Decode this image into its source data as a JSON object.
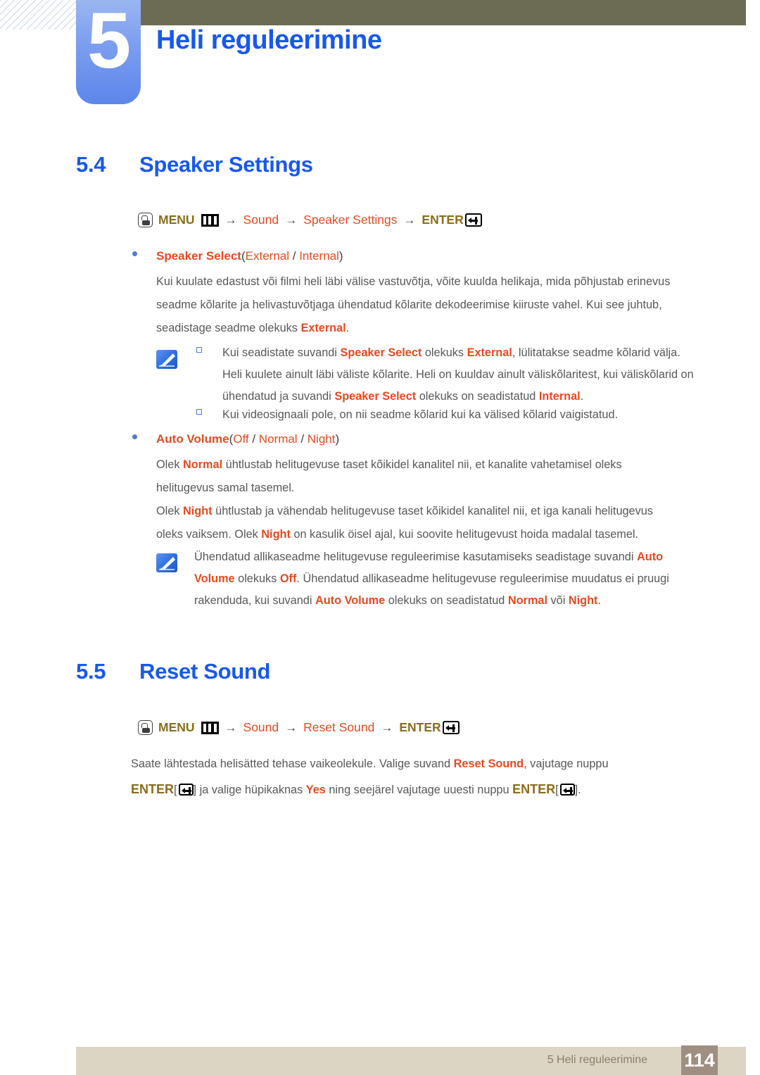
{
  "header": {
    "chapter_number": "5",
    "chapter_title": "Heli reguleerimine"
  },
  "sections": [
    {
      "number": "5.4",
      "title": "Speaker Settings",
      "menu_path": {
        "menu_label": "MENU",
        "arrow": "→",
        "step1": "Sound",
        "step2": "Speaker Settings",
        "enter_label": "ENTER"
      },
      "bullet": {
        "name": "Speaker Select",
        "options_open": "(",
        "option1": "External",
        "sep": " / ",
        "option2": "Internal",
        "options_close": ")"
      },
      "paragraph": {
        "line1_a": "Kui kuulate edastust või filmi heli läbi välise vastuvõtja, võite kuulda helikaja, mida põhjustab erinevus",
        "line2_a": "seadme kõlarite ja helivastuvõtjaga ühendatud kõlarite dekodeerimise kiiruste vahel. Kui see juhtub,",
        "line3_a": "seadistage seadme olekuks ",
        "line3_b": "External",
        "line3_c": "."
      },
      "note": {
        "item1": {
          "l1_a": "Kui seadistate suvandi ",
          "l1_b": "Speaker Select",
          "l1_c": " olekuks ",
          "l1_d": "External",
          "l1_e": ", lülitatakse seadme kõlarid välja.",
          "l2": "Heli kuulete ainult läbi väliste kõlarite. Heli on kuuldav ainult väliskõlaritest, kui väliskõlarid on",
          "l3_a": "ühendatud ja suvandi ",
          "l3_b": "Speaker Select",
          "l3_c": " olekuks on seadistatud ",
          "l3_d": "Internal",
          "l3_e": "."
        },
        "item2": {
          "l1": "Kui videosignaali pole, on nii seadme kõlarid kui ka välised kõlarid vaigistatud."
        }
      }
    }
  ],
  "auto_volume": {
    "bullet": {
      "name": "Auto Volume",
      "options_open": "(",
      "option1": "Off",
      "sep1": " / ",
      "option2": "Normal",
      "sep2": " / ",
      "option3": "Night",
      "options_close": ")"
    },
    "para1": {
      "l1_a": "Olek ",
      "l1_b": "Normal",
      "l1_c": " ühtlustab helitugevuse taset kõikidel kanalitel nii, et kanalite vahetamisel oleks",
      "l2": "helitugevus samal tasemel."
    },
    "para2": {
      "l1_a": "Olek ",
      "l1_b": "Night",
      "l1_c": " ühtlustab ja vähendab helitugevuse taset kõikidel kanalitel nii, et iga kanali helitugevus",
      "l2_a": "oleks vaiksem. Olek ",
      "l2_b": "Night",
      "l2_c": " on kasulik öisel ajal, kui soovite helitugevust hoida madalal tasemel."
    },
    "note": {
      "l1_a": "Ühendatud allikaseadme helitugevuse reguleerimise kasutamiseks seadistage suvandi ",
      "l1_b": "Auto",
      "l2_a": "Volume",
      "l2_b": " olekuks ",
      "l2_c": "Off",
      "l2_d": ". Ühendatud allikaseadme helitugevuse reguleerimise muudatus ei pruugi",
      "l3_a": "rakenduda, kui suvandi ",
      "l3_b": "Auto Volume",
      "l3_c": " olekuks on seadistatud ",
      "l3_d": "Normal",
      "l3_e": " või ",
      "l3_f": "Night",
      "l3_g": "."
    }
  },
  "reset_sound": {
    "number": "5.5",
    "title": "Reset Sound",
    "menu_path": {
      "menu_label": "MENU",
      "arrow": "→",
      "step1": "Sound",
      "step2": "Reset Sound",
      "enter_label": "ENTER"
    },
    "paragraph": {
      "l1_a": "Saate lähtestada helisätted tehase vaikeolekule. Valige suvand ",
      "l1_b": "Reset Sound",
      "l1_c": ", vajutage nuppu",
      "l2_a": "ENTER",
      "l2_b": "[",
      "l2_c": "]",
      "l2_d": " ja valige hüpikaknas ",
      "l2_e": "Yes",
      "l2_f": " ning seejärel vajutage uuesti nuppu ",
      "l2_g": "ENTER",
      "l2_h": "[",
      "l2_i": "].",
      "icon": "enter-key-icon"
    }
  },
  "footer": {
    "text": "5 Heli reguleerimine",
    "page_number": "114"
  },
  "colors": {
    "accent_blue": "#1758ee",
    "orange": "#e8491e",
    "gold": "#8a6d1c",
    "olive": "#6c6b54",
    "footer_bar": "#dcd5c3",
    "footer_page": "#9f8f82",
    "bullet_blue": "#5179d6"
  }
}
